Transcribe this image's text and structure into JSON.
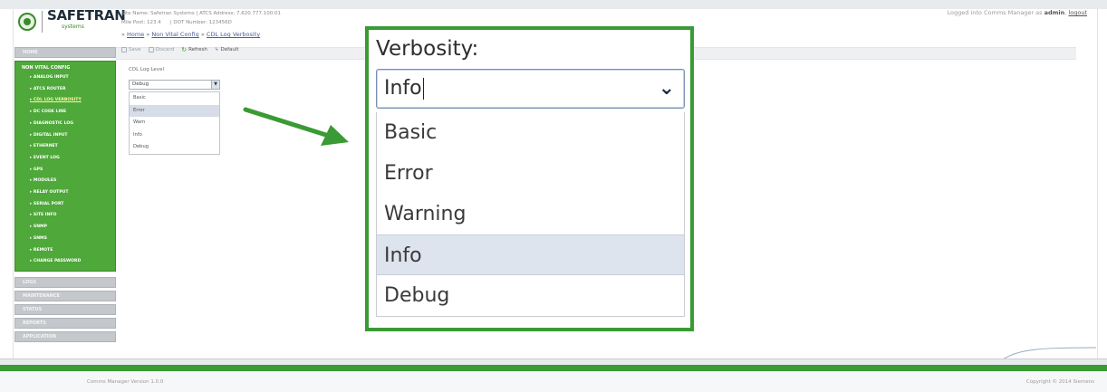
{
  "header": {
    "brand": "SAFETRAN",
    "brand_tag": "systems",
    "site_line_1": "Site Name: Safetran Systems  |  ATCS Address: 7.620.777.100.01",
    "site_line_2a": "Mile Post:  123.4",
    "site_line_2b": "|  DOT Number:  123456D",
    "login_text": "Logged into Comms Manager as",
    "login_user": "admin",
    "logout_label": "logout"
  },
  "breadcrumb": {
    "items": [
      "Home",
      "Non Vital Config",
      "CDL Log Verbosity"
    ]
  },
  "toolbar": {
    "save_label": "Save",
    "discard_label": "Discard",
    "refresh_label": "Refresh",
    "default_label": "Default"
  },
  "sidebar": {
    "top_item": "HOME",
    "group_label": "NON VITAL CONFIG",
    "group_items": [
      "ANALOG INPUT",
      "ATCS ROUTER",
      "CDL LOG VERBOSITY",
      "DC CODE LINE",
      "DIAGNOSTIC LOG",
      "DIGITAL INPUT",
      "ETHERNET",
      "EVENT LOG",
      "GPS",
      "MODULES",
      "RELAY OUTPUT",
      "SERIAL PORT",
      "SITE INFO",
      "SNMP",
      "SNMS",
      "REMOTE",
      "CHANGE PASSWORD"
    ],
    "active_index": 2,
    "bottom_items": [
      "LOGS",
      "MAINTENANCE",
      "STATUS",
      "REPORTS",
      "APPLICATION"
    ]
  },
  "main": {
    "field_label": "CDL Log Level",
    "select_value": "Debug",
    "options": [
      "Basic",
      "Error",
      "Warn",
      "Info",
      "Debug"
    ],
    "highlighted_index": 1
  },
  "zoom": {
    "title": "Verbosity:",
    "value": "Info",
    "options": [
      "Basic",
      "Error",
      "Warning",
      "Info",
      "Debug"
    ],
    "highlighted_index": 3
  },
  "footer": {
    "version": "Comms Manager Version 1.0.0",
    "copyright": "Copyright © 2014 Siemens"
  },
  "colors": {
    "accent_green": "#3a9a34",
    "sidebar_green": "#4fa83a",
    "link_blue": "#4a5c9a"
  },
  "icons": {
    "arrow": "right-pointing green arrow",
    "select_chevron": "chevron-down-icon"
  }
}
